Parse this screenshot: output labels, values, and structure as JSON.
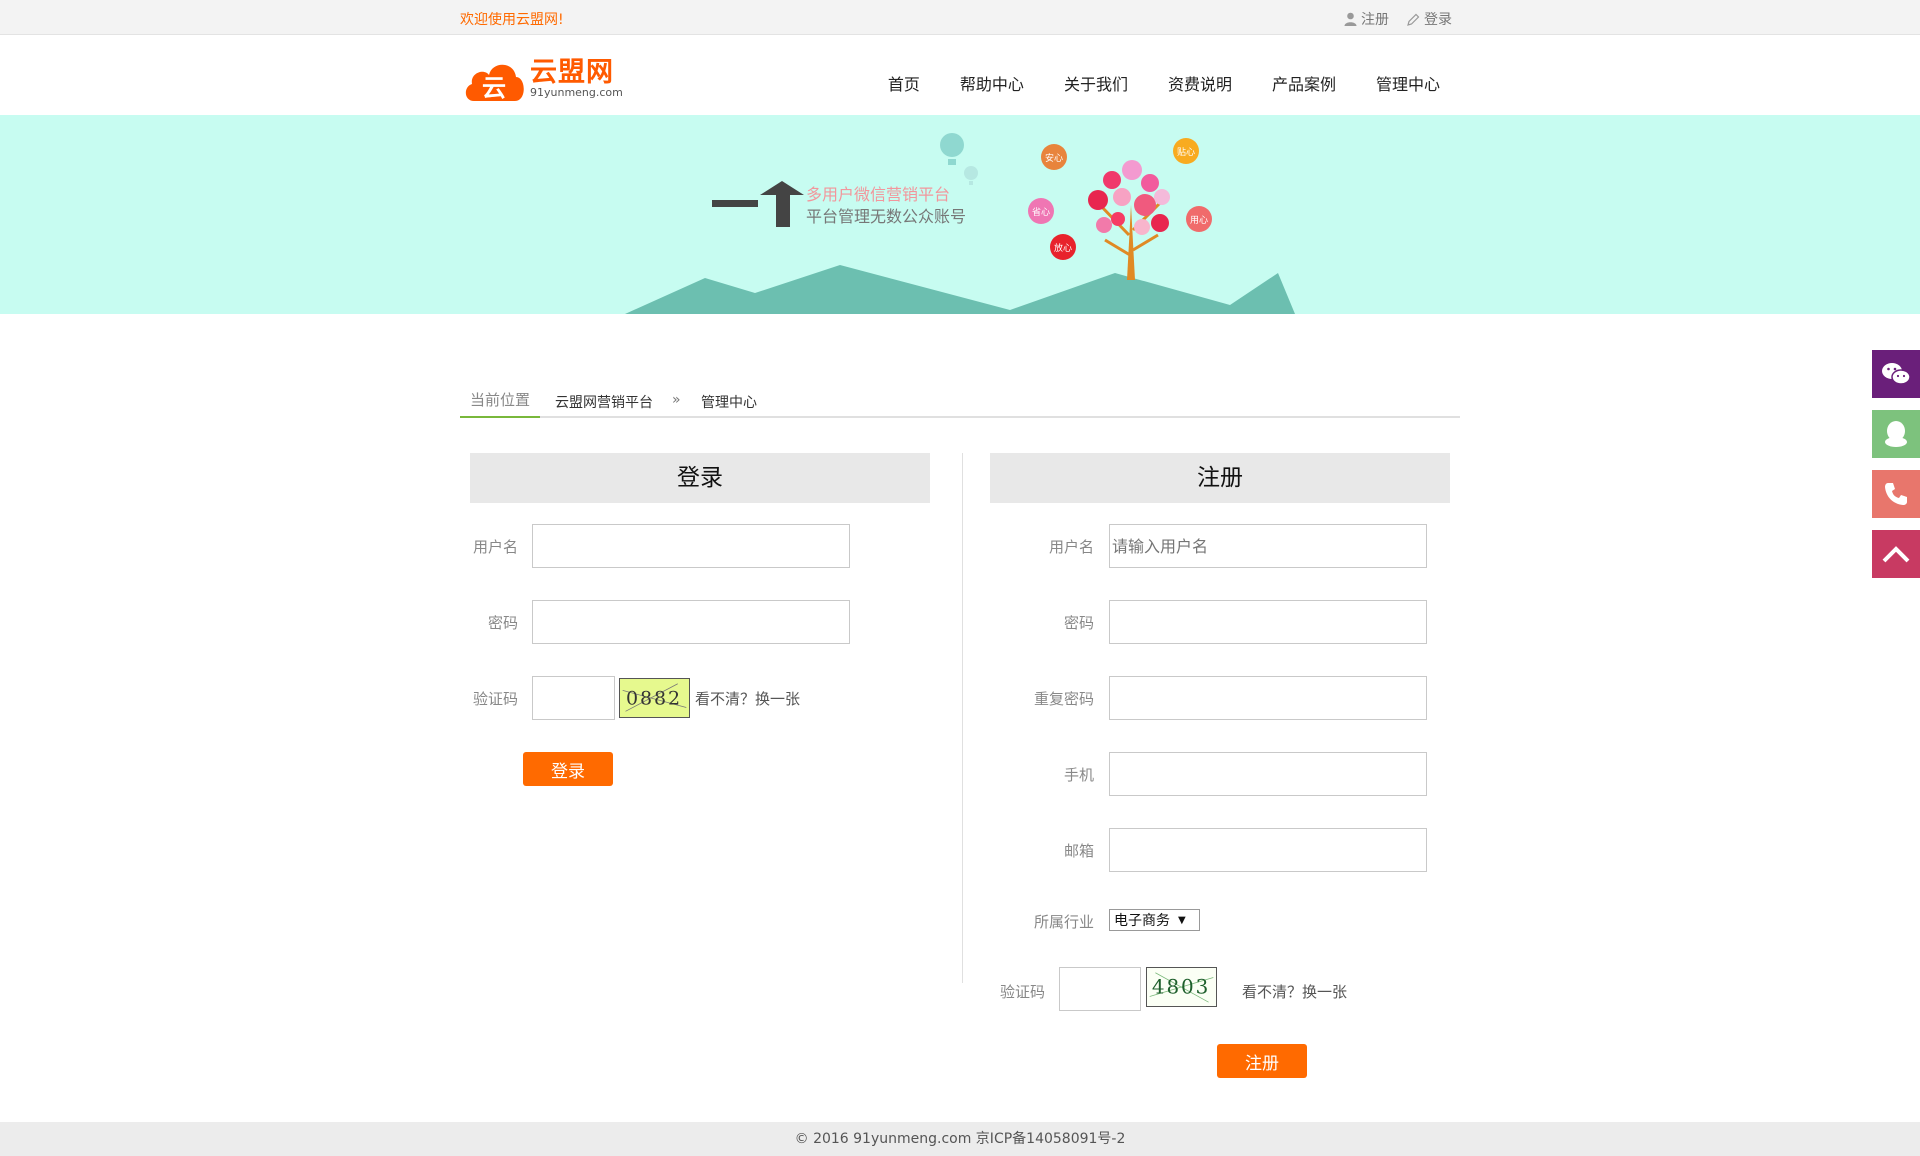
{
  "topbar": {
    "welcome": "欢迎使用云盟网!",
    "register_label": "注册",
    "login_label": "登录"
  },
  "header": {
    "logo_char": "云",
    "brand_name": "云盟网",
    "brand_domain": "91yunmeng.com",
    "nav": [
      "首页",
      "帮助中心",
      "关于我们",
      "资费说明",
      "产品案例",
      "管理中心"
    ]
  },
  "banner": {
    "line1": "多用户微信营销平台",
    "line2": "平台管理无数公众账号",
    "bubbles": [
      "安心",
      "贴心",
      "省心",
      "用心",
      "放心"
    ]
  },
  "breadcrumb": {
    "current": "当前位置",
    "items": [
      "云盟网营销平台",
      "管理中心"
    ],
    "separator": "»"
  },
  "login": {
    "title": "登录",
    "username_label": "用户名",
    "password_label": "密码",
    "captcha_label": "验证码",
    "captcha_text": "0882",
    "refresh_text": "看不清？换一张",
    "submit_label": "登录"
  },
  "register": {
    "title": "注册",
    "username_label": "用户名",
    "username_placeholder": "请输入用户名",
    "password_label": "密码",
    "repeat_password_label": "重复密码",
    "phone_label": "手机",
    "email_label": "邮箱",
    "industry_label": "所属行业",
    "industry_selected": "电子商务",
    "captcha_label": "验证码",
    "captcha_text": "4803",
    "refresh_text": "看不清？换一张",
    "submit_label": "注册"
  },
  "side_bar": {
    "buttons": [
      "wechat-icon",
      "qq-icon",
      "phone-icon",
      "back-to-top-icon"
    ],
    "colors": [
      "#6a1f7a",
      "#7dc27d",
      "#e8766c",
      "#c83a62"
    ]
  },
  "footer": {
    "copyright": "© 2016 91yunmeng.com 京ICP备14058091号-2"
  },
  "colors": {
    "accent": "#ff6a00",
    "banner_bg": "#c7fcf1",
    "mountain": "#6cbfb0"
  }
}
